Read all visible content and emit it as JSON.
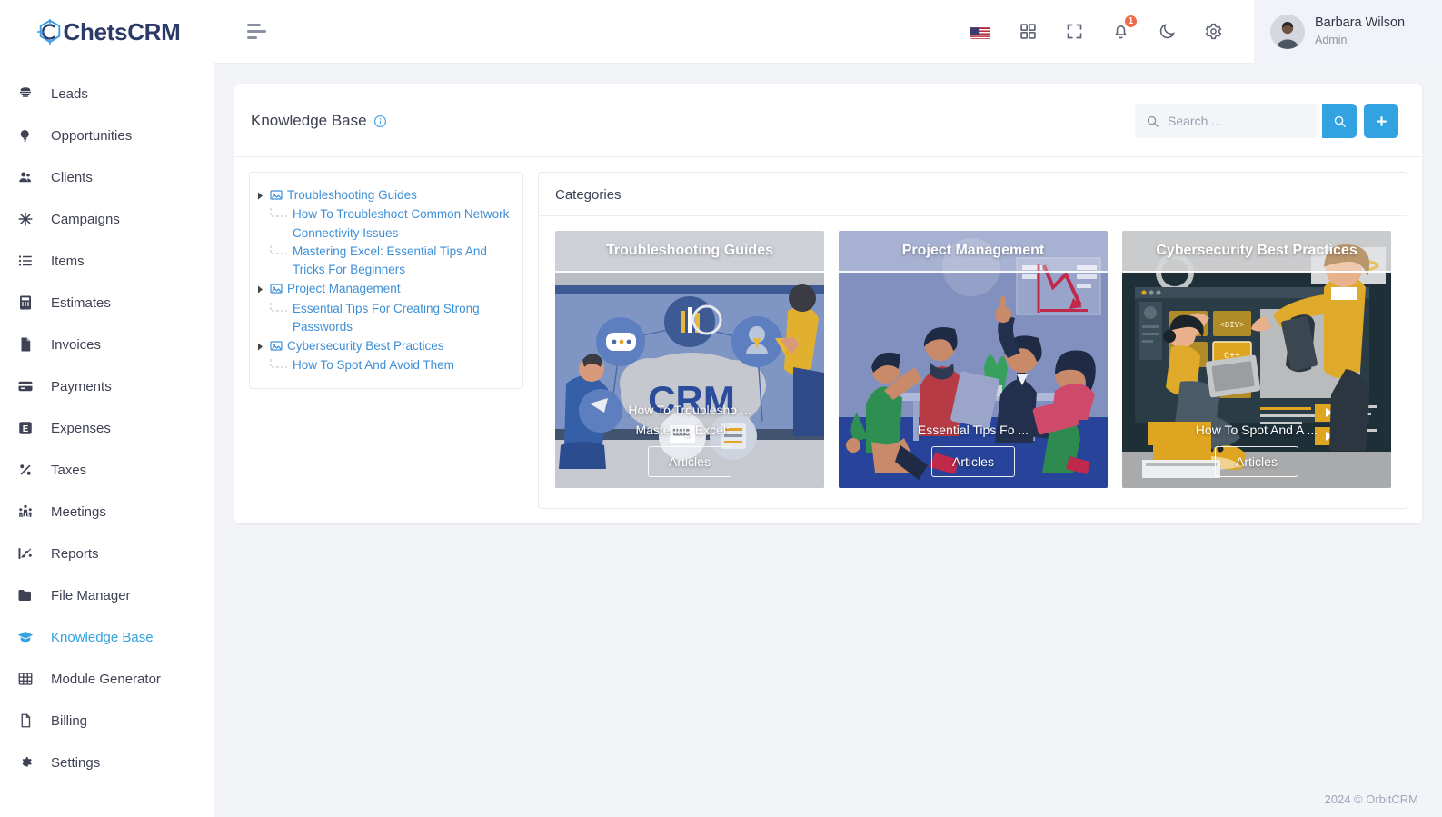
{
  "brand": {
    "name": "ChetsCRM",
    "icon": "crm-logo-icon"
  },
  "sidebar": {
    "items": [
      {
        "label": "Leads",
        "icon": "leads-icon",
        "active": false
      },
      {
        "label": "Opportunities",
        "icon": "opportunities-icon",
        "active": false
      },
      {
        "label": "Clients",
        "icon": "clients-icon",
        "active": false
      },
      {
        "label": "Campaigns",
        "icon": "campaigns-icon",
        "active": false
      },
      {
        "label": "Items",
        "icon": "items-icon",
        "active": false
      },
      {
        "label": "Estimates",
        "icon": "estimates-icon",
        "active": false
      },
      {
        "label": "Invoices",
        "icon": "invoices-icon",
        "active": false
      },
      {
        "label": "Payments",
        "icon": "payments-icon",
        "active": false
      },
      {
        "label": "Expenses",
        "icon": "expenses-icon",
        "active": false
      },
      {
        "label": "Taxes",
        "icon": "taxes-icon",
        "active": false
      },
      {
        "label": "Meetings",
        "icon": "meetings-icon",
        "active": false
      },
      {
        "label": "Reports",
        "icon": "reports-icon",
        "active": false
      },
      {
        "label": "File Manager",
        "icon": "folder-icon",
        "active": false
      },
      {
        "label": "Knowledge Base",
        "icon": "graduation-cap-icon",
        "active": true
      },
      {
        "label": "Module Generator",
        "icon": "grid-icon",
        "active": false
      },
      {
        "label": "Billing",
        "icon": "billing-icon",
        "active": false
      },
      {
        "label": "Settings",
        "icon": "gear-icon",
        "active": false
      }
    ]
  },
  "topbar": {
    "menu_toggle": "hamburger-icon",
    "icons": [
      {
        "name": "language-flag-us"
      },
      {
        "name": "apps-grid-icon"
      },
      {
        "name": "fullscreen-icon"
      },
      {
        "name": "notifications-bell-icon",
        "badge": "1"
      },
      {
        "name": "dark-mode-moon-icon"
      },
      {
        "name": "settings-gear-icon"
      }
    ],
    "user": {
      "name": "Barbara Wilson",
      "role": "Admin"
    }
  },
  "page": {
    "title": "Knowledge Base",
    "info_icon": "info-circle-icon"
  },
  "search": {
    "placeholder": "Search ...",
    "value": "",
    "search_button_icon": "search-icon",
    "add_button_icon": "plus-icon"
  },
  "tree": {
    "nodes": [
      {
        "label": "Troubleshooting Guides",
        "children": [
          "How To Troubleshoot Common Network Connectivity Issues",
          "Mastering Excel: Essential Tips And Tricks For Beginners"
        ]
      },
      {
        "label": "Project Management",
        "children": [
          "Essential Tips For Creating Strong Passwords"
        ]
      },
      {
        "label": "Cybersecurity Best Practices",
        "children": [
          "How To Spot And Avoid Them"
        ]
      }
    ]
  },
  "categories": {
    "heading": "Categories",
    "cards": [
      {
        "title": "Troubleshooting Guides",
        "articles": [
          "How To Troublesho ...",
          "Mastering Excel: ..."
        ],
        "button": "Articles",
        "theme": "crm-network",
        "accent": "#9b9fa8"
      },
      {
        "title": "Project Management",
        "articles": [
          "Essential Tips Fo ..."
        ],
        "button": "Articles",
        "theme": "team-meeting",
        "accent": "#2b4c9b"
      },
      {
        "title": "Cybersecurity Best Practices",
        "articles": [
          "How To Spot And A ..."
        ],
        "button": "Articles",
        "theme": "coding-lesson",
        "accent": "#b0b2b4"
      }
    ]
  },
  "footer": {
    "copyright": "2024 © OrbitCRM"
  },
  "colors": {
    "accent": "#32a2e0",
    "link": "#3d8fd6",
    "badge": "#f0694a",
    "brand_text": "#2b3a67",
    "page_bg": "#f3f4f8"
  }
}
